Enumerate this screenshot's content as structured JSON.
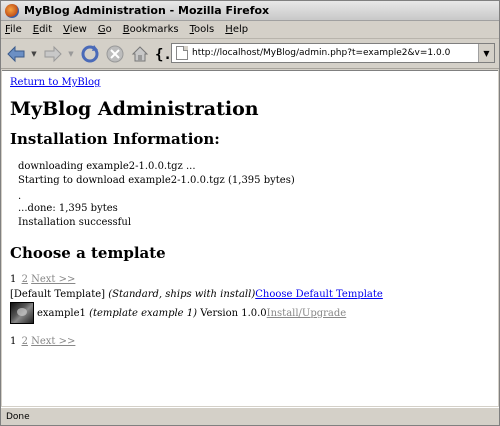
{
  "window": {
    "title": "MyBlog Administration - Mozilla Firefox"
  },
  "menu": {
    "items": [
      {
        "ul": "F",
        "rest": "ile"
      },
      {
        "ul": "E",
        "rest": "dit"
      },
      {
        "ul": "V",
        "rest": "iew"
      },
      {
        "ul": "G",
        "rest": "o"
      },
      {
        "ul": "B",
        "rest": "ookmarks"
      },
      {
        "ul": "T",
        "rest": "ools"
      },
      {
        "ul": "H",
        "rest": "elp"
      }
    ]
  },
  "navigation": {
    "url": "http://localhost/MyBlog/admin.php?t=example2&v=1.0.0"
  },
  "page": {
    "return_link": "Return to MyBlog",
    "title": "MyBlog Administration",
    "install_heading": "Installation Information:",
    "log": {
      "line1": "downloading example2-1.0.0.tgz ...",
      "line2": "Starting to download example2-1.0.0.tgz (1,395 bytes)",
      "line3": ".",
      "line4": "...done: 1,395 bytes",
      "line5": "Installation successful"
    },
    "template_heading": "Choose a template",
    "pager": {
      "current": "1",
      "page2": "2",
      "next": "Next >>"
    },
    "default_template": {
      "name": "[Default Template]",
      "desc": "(Standard, ships with install)",
      "link": "Choose Default Template"
    },
    "template1": {
      "name": "example1",
      "desc": "(template example 1)",
      "version": "Version 1.0.0",
      "link": "Install/Upgrade"
    }
  },
  "status": {
    "text": "Done"
  }
}
